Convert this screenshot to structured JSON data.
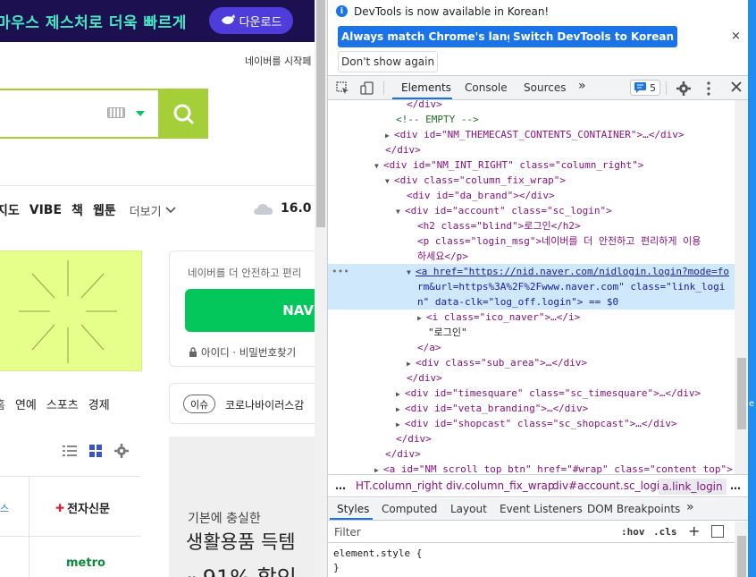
{
  "naver": {
    "promo_text": "마우스 제스처로 더욱 빠르게",
    "promo_button": "다운로드",
    "start_link": "네이버를 시작페",
    "nav_services": [
      "지도",
      "VIBE",
      "책",
      "웹툰"
    ],
    "nav_more": "더보기",
    "temperature": "16.0",
    "login_msg": "네이버를 더 안전하고 편리",
    "login_button": "NAV",
    "login_sub": "아이디 · 비밀번호찾기",
    "news_tabs": [
      "홈",
      "연예",
      "스포츠",
      "경제"
    ],
    "issue_badge": "이슈",
    "issue_text": "코로나바이러스감",
    "press": {
      "s": "스",
      "etnews": "전자신문",
      "metro": "metro"
    },
    "shop": {
      "line1": "기본에 충실한",
      "line2": "생활용품 득템",
      "line3_prefix": "최",
      "line3": "91% 할인"
    }
  },
  "devtools": {
    "info_text": "DevTools is now available in Korean!",
    "btn_match": "Always match Chrome's language",
    "btn_switch": "Switch DevTools to Korean",
    "btn_dont_show": "Don't show again",
    "close": "×",
    "tabs": [
      "Elements",
      "Console",
      "Sources"
    ],
    "tabs_more": "»",
    "issues_count": "5",
    "dom_lines": [
      {
        "text": "</div>"
      },
      {
        "text": "<!-- EMPTY -->"
      },
      {
        "text": "<div id=\"NM_THEMECAST_CONTENTS_CONTAINER\">…</div>"
      },
      {
        "text": "</div>"
      },
      {
        "text": "<div id=\"NM_INT_RIGHT\" class=\"column_right\">"
      },
      {
        "text": "<div class=\"column_fix_wrap\">"
      },
      {
        "text": "<div id=\"da_brand\"></div>"
      },
      {
        "text": "<div id=\"account\" class=\"sc_login\">"
      },
      {
        "text": "<h2 class=\"blind\">로그인</h2>"
      },
      {
        "text": "<p class=\"login_msg\">네이버를 더 안전하고 편리하게 이용"
      },
      {
        "text": "하세요</p>"
      },
      {
        "text": "<a href=\"https://nid.naver.com/nidlogin.login?mode=fo"
      },
      {
        "text": "rm&url=https%3A%2F%2Fwww.naver.com\" class=\"link_logi"
      },
      {
        "text": "n\" data-clk=\"log_off.login\"> == $0"
      },
      {
        "text": "<i class=\"ico_naver\">…</i>"
      },
      {
        "text": "\"로그인\""
      },
      {
        "text": "</a>"
      },
      {
        "text": "<div class=\"sub_area\">…</div>"
      },
      {
        "text": "</div>"
      },
      {
        "text": "<div id=\"timesquare\" class=\"sc_timesquare\">…</div>"
      },
      {
        "text": "<div id=\"veta_branding\">…</div>"
      },
      {
        "text": "<div id=\"shopcast\" class=\"sc_shopcast\">…</div>"
      },
      {
        "text": "</div>"
      },
      {
        "text": "</div>"
      },
      {
        "text": "<a id=\"NM_scroll_top_btn\" href=\"#wrap\" class=\"content_top\">"
      }
    ],
    "breadcrumbs": [
      "…",
      "HT.column_right",
      "div.column_fix_wrap",
      "div#account.sc_login",
      "a.link_login",
      "…"
    ],
    "style_tabs": [
      "Styles",
      "Computed",
      "Layout",
      "Event Listeners",
      "DOM Breakpoints"
    ],
    "style_tabs_more": "»",
    "filter_placeholder": "Filter",
    "hov": ":hov",
    "cls": ".cls",
    "plus": "+",
    "element_style_open": "element.style {",
    "element_style_close": "}",
    "dots": "•••",
    "right_edge_char": "e"
  },
  "colors": {
    "naver_green": "#03c75a",
    "search_green": "#a4cf38",
    "devtools_blue": "#1a73e8",
    "promo_bg": "#1c1050",
    "promo_text": "#42e7c3"
  }
}
